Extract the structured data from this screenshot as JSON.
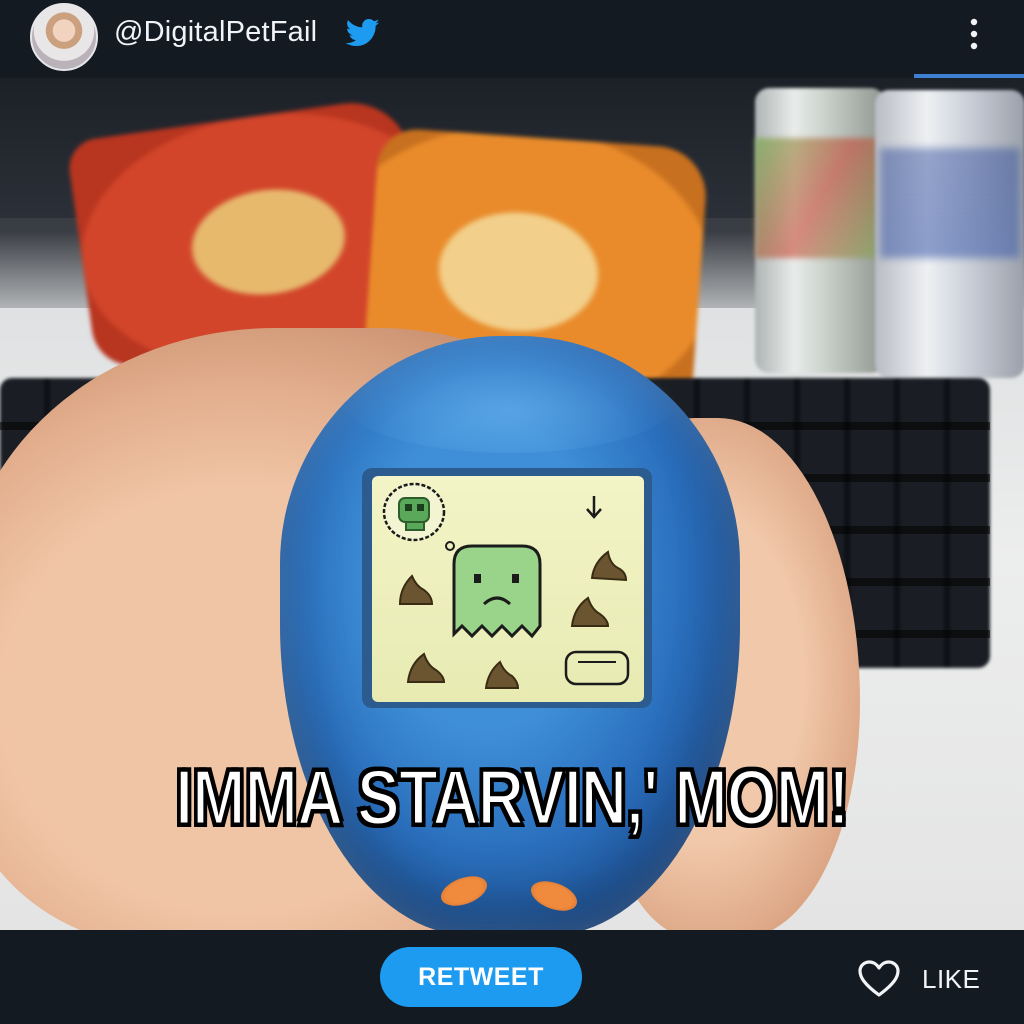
{
  "post": {
    "author_handle": "@DigitalPetFail",
    "verified_icon": "twitter-bird-icon",
    "menu_icon": "more-vertical-icon",
    "caption": "IMMA STARVIN,' MOM!"
  },
  "actions": {
    "retweet_label": "RETWEET",
    "like_label": "LIKE",
    "like_icon": "heart-outline-icon"
  },
  "colors": {
    "header_bg": "#141a22",
    "accent": "#1d9bf0",
    "pet_screen": "#eef0bd",
    "pet_green": "#8fcf7e",
    "device_blue": "#2a6fbd"
  }
}
